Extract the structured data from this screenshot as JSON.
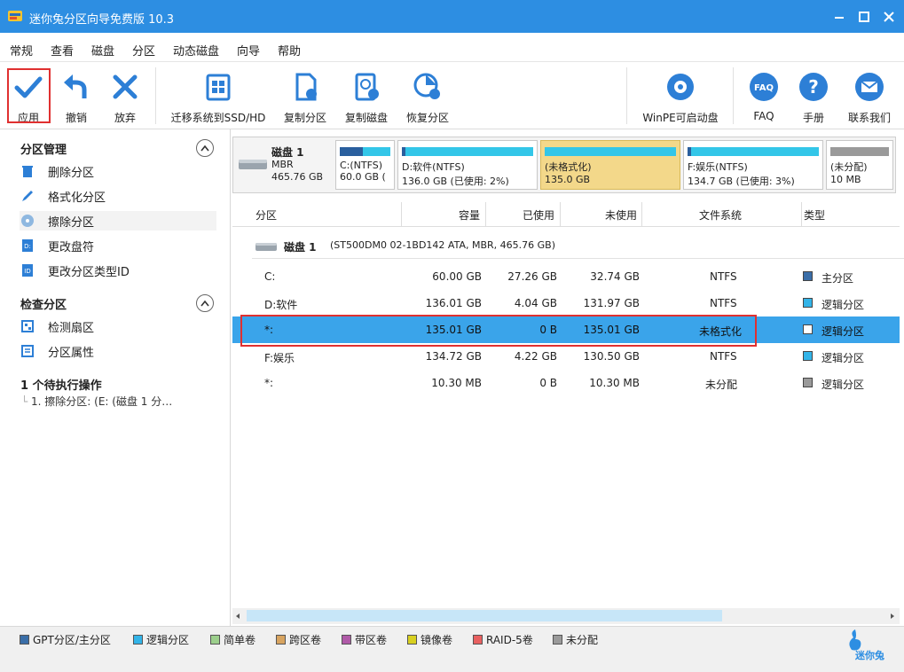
{
  "window": {
    "title": "迷你兔分区向导免费版 10.3"
  },
  "menu": [
    "常规",
    "查看",
    "磁盘",
    "分区",
    "动态磁盘",
    "向导",
    "帮助"
  ],
  "toolbar": {
    "apply": "应用",
    "undo": "撤销",
    "discard": "放弃",
    "migrate": "迁移系统到SSD/HD",
    "copy_partition": "复制分区",
    "copy_disk": "复制磁盘",
    "recover_partition": "恢复分区",
    "winpe": "WinPE可启动盘",
    "faq": "FAQ",
    "manual": "手册",
    "contact": "联系我们"
  },
  "sidebar": {
    "partition_mgmt": {
      "title": "分区管理",
      "items": [
        "删除分区",
        "格式化分区",
        "擦除分区",
        "更改盘符",
        "更改分区类型ID"
      ]
    },
    "check_partition": {
      "title": "检查分区",
      "items": [
        "检测扇区",
        "分区属性"
      ]
    },
    "pending": {
      "title": "1 个待执行操作",
      "items": [
        "1. 擦除分区: (E: (磁盘 1 分…"
      ]
    }
  },
  "diskmap": {
    "disk": {
      "name": "磁盘  1",
      "type": "MBR",
      "size": "465.76 GB"
    },
    "parts": [
      {
        "l1": "C:(NTFS)",
        "l2": "60.0 GB (",
        "fill": 0.45,
        "color": "#3a6ea8"
      },
      {
        "l1": "D:软件(NTFS)",
        "l2": "136.0 GB (已使用: 2%)",
        "fill": 0.03,
        "color": "#1a9bd8"
      },
      {
        "l1": "(未格式化)",
        "l2": "135.0 GB",
        "fill": 0.0,
        "color": "#1a9bd8"
      },
      {
        "l1": "F:娱乐(NTFS)",
        "l2": "134.7 GB (已使用: 3%)",
        "fill": 0.03,
        "color": "#1a9bd8"
      },
      {
        "l1": "(未分配)",
        "l2": "10 MB",
        "fill": 0.0,
        "color": "#9a9a9a"
      }
    ]
  },
  "table": {
    "headers": [
      "分区",
      "容量",
      "已使用",
      "未使用",
      "文件系统",
      "类型"
    ],
    "disk_row": {
      "name": "磁盘  1",
      "detail": "(ST500DM0 02-1BD142 ATA, MBR, 465.76 GB)"
    },
    "rows": [
      {
        "name": "C:",
        "cap": "60.00 GB",
        "used": "27.26 GB",
        "free": "32.74 GB",
        "fs": "NTFS",
        "type": "主分区",
        "color": "#3a6ea8"
      },
      {
        "name": "D:软件",
        "cap": "136.01 GB",
        "used": "4.04 GB",
        "free": "131.97 GB",
        "fs": "NTFS",
        "type": "逻辑分区",
        "color": "#33b4e8"
      },
      {
        "name": "*:",
        "cap": "135.01 GB",
        "used": "0 B",
        "free": "135.01 GB",
        "fs": "未格式化",
        "type": "逻辑分区",
        "color": "#ffffff"
      },
      {
        "name": "F:娱乐",
        "cap": "134.72 GB",
        "used": "4.22 GB",
        "free": "130.50 GB",
        "fs": "NTFS",
        "type": "逻辑分区",
        "color": "#33b4e8"
      },
      {
        "name": "*:",
        "cap": "10.30 MB",
        "used": "0 B",
        "free": "10.30 MB",
        "fs": "未分配",
        "type": "逻辑分区",
        "color": "#9a9a9a"
      }
    ]
  },
  "legend": [
    {
      "label": "GPT分区/主分区",
      "color": "#3a6ea8"
    },
    {
      "label": "逻辑分区",
      "color": "#33b4e8"
    },
    {
      "label": "简单卷",
      "color": "#9ccf8c"
    },
    {
      "label": "跨区卷",
      "color": "#d8a460"
    },
    {
      "label": "带区卷",
      "color": "#b05aa8"
    },
    {
      "label": "镜像卷",
      "color": "#d8d020"
    },
    {
      "label": "RAID-5卷",
      "color": "#e86060"
    },
    {
      "label": "未分配",
      "color": "#9a9a9a"
    }
  ],
  "brand": "迷你兔"
}
